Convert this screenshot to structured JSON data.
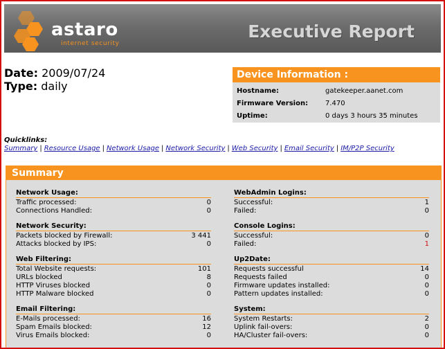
{
  "header": {
    "logo_word": "astaro",
    "logo_sub": "internet security",
    "title": "Executive Report"
  },
  "meta": {
    "date_label": "Date:",
    "date_value": "2009/07/24",
    "type_label": "Type:",
    "type_value": "daily"
  },
  "device": {
    "title": "Device Information :",
    "rows": [
      {
        "label": "Hostname:",
        "value": "gatekeeper.aanet.com"
      },
      {
        "label": "Firmware Version:",
        "value": "7.470"
      },
      {
        "label": "Uptime:",
        "value": "0 days 3 hours 35 minutes"
      }
    ]
  },
  "quicklinks": {
    "title": "Quicklinks:",
    "links": [
      "Summary",
      "Resource Usage",
      "Network Usage",
      "Network Security",
      "Web Security",
      "Email Security",
      "IM/P2P Security"
    ]
  },
  "summary": {
    "title": "Summary",
    "left": [
      {
        "title": "Network Usage:",
        "rows": [
          {
            "label": "Traffic processed:",
            "value": "0"
          },
          {
            "label": "Connections Handled:",
            "value": "0"
          }
        ]
      },
      {
        "title": "Network Security:",
        "rows": [
          {
            "label": "Packets blocked by Firewall:",
            "value": "3 441"
          },
          {
            "label": "Attacks blocked by IPS:",
            "value": "0"
          }
        ]
      },
      {
        "title": "Web Filtering:",
        "rows": [
          {
            "label": "Total Website requests:",
            "value": "101"
          },
          {
            "label": "URLs blocked",
            "value": "8"
          },
          {
            "label": "HTTP Viruses blocked",
            "value": "0"
          },
          {
            "label": "HTTP Malware blocked",
            "value": "0"
          }
        ]
      },
      {
        "title": "Email Filtering:",
        "rows": [
          {
            "label": "E-Mails processed:",
            "value": "16"
          },
          {
            "label": "Spam Emails blocked:",
            "value": "12"
          },
          {
            "label": "Virus Emails blocked:",
            "value": "0"
          }
        ]
      }
    ],
    "right": [
      {
        "title": "WebAdmin Logins:",
        "rows": [
          {
            "label": "Successful:",
            "value": "1"
          },
          {
            "label": "Failed:",
            "value": "0"
          }
        ]
      },
      {
        "title": "Console Logins:",
        "rows": [
          {
            "label": "Successful:",
            "value": "0"
          },
          {
            "label": "Failed:",
            "value": "1",
            "alert": true
          }
        ]
      },
      {
        "title": "Up2Date:",
        "rows": [
          {
            "label": "Requests successful",
            "value": "14"
          },
          {
            "label": "Requests failed",
            "value": "0"
          },
          {
            "label": "Firmware updates installed:",
            "value": "0"
          },
          {
            "label": "Pattern updates installed:",
            "value": "0"
          }
        ]
      },
      {
        "title": "System:",
        "rows": [
          {
            "label": "System Restarts:",
            "value": "2"
          },
          {
            "label": "Uplink fail-overs:",
            "value": "0"
          },
          {
            "label": "HA/Cluster fail-overs:",
            "value": "0"
          }
        ]
      }
    ]
  },
  "colors": {
    "accent": "#f7931e",
    "frame": "#d21010",
    "link": "#1a1aa6",
    "panel": "#dcdcdc"
  }
}
